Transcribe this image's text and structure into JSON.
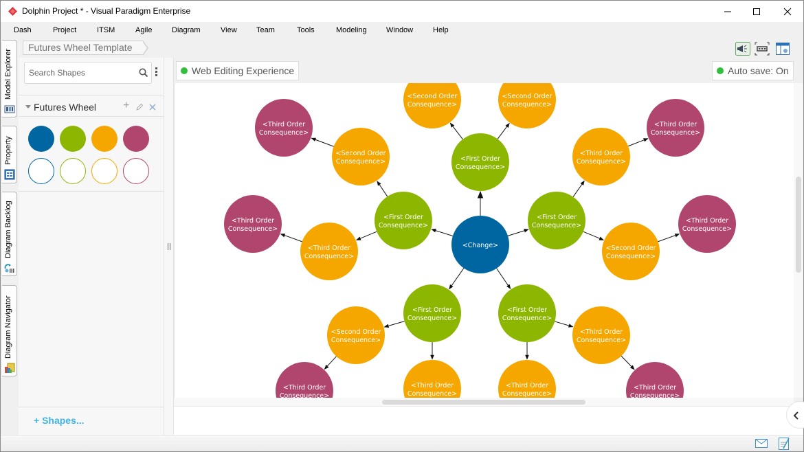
{
  "window": {
    "title": "Dolphin Project * - Visual Paradigm Enterprise",
    "controls": {
      "minimize": "minimize",
      "maximize": "maximize",
      "close": "close"
    }
  },
  "menubar": {
    "items": [
      {
        "label": "Dash"
      },
      {
        "label": "Project"
      },
      {
        "label": "ITSM"
      },
      {
        "label": "Agile"
      },
      {
        "label": "Diagram"
      },
      {
        "label": "View"
      },
      {
        "label": "Team"
      },
      {
        "label": "Tools"
      },
      {
        "label": "Modeling"
      },
      {
        "label": "Window"
      },
      {
        "label": "Help"
      }
    ]
  },
  "left_tabs": [
    {
      "label": "Model Explorer",
      "icon": "model-explorer-icon"
    },
    {
      "label": "Property",
      "icon": "property-icon"
    },
    {
      "label": "Diagram Backlog",
      "icon": "diagram-backlog-icon"
    },
    {
      "label": "Diagram Navigator",
      "icon": "diagram-navigator-icon"
    }
  ],
  "breadcrumb": {
    "label": "Futures Wheel Template"
  },
  "toolbar": {
    "icons": [
      "announcement-icon",
      "fit-diagram-icon",
      "layout-panel-icon"
    ]
  },
  "shape_panel": {
    "search_placeholder": "Search Shapes",
    "search_value": "",
    "category": {
      "title": "Futures Wheel",
      "actions": [
        "add",
        "edit",
        "close"
      ]
    },
    "swatches": [
      {
        "style": "filled",
        "color": "#0066a1"
      },
      {
        "style": "filled",
        "color": "#8db600"
      },
      {
        "style": "filled",
        "color": "#f5a700"
      },
      {
        "style": "filled",
        "color": "#b0466d"
      },
      {
        "style": "outline",
        "color": "#0066a1"
      },
      {
        "style": "outline",
        "color": "#8db600"
      },
      {
        "style": "outline",
        "color": "#f5a700"
      },
      {
        "style": "outline",
        "color": "#b0466d"
      }
    ],
    "add_shapes_label": "Shapes..."
  },
  "canvas_header": {
    "web_editing_label": "Web Editing Experience",
    "autosave_label": "Auto save: On",
    "status_color": "#2fbf3c"
  },
  "diagram": {
    "colors": {
      "change": "#0066a1",
      "first": "#8db600",
      "second": "#f5a700",
      "third_orange": "#f5a700",
      "third": "#b0466d"
    },
    "nodes": [
      {
        "id": "c",
        "kind": "change",
        "line1": "<Change>",
        "line2": ""
      },
      {
        "id": "f1",
        "kind": "first",
        "line1": "<First Order",
        "line2": "Consequence>"
      },
      {
        "id": "f2",
        "kind": "first",
        "line1": "<First Order",
        "line2": "Consequence>"
      },
      {
        "id": "f3",
        "kind": "first",
        "line1": "<First Order",
        "line2": "Consequence>"
      },
      {
        "id": "f4",
        "kind": "first",
        "line1": "<First Order",
        "line2": "Consequence>"
      },
      {
        "id": "f5",
        "kind": "first",
        "line1": "<First Order",
        "line2": "Consequence>"
      },
      {
        "id": "s1",
        "kind": "second",
        "line1": "<Second Order",
        "line2": "Consequence>"
      },
      {
        "id": "s2",
        "kind": "second",
        "line1": "<Second Order",
        "line2": "Consequence>"
      },
      {
        "id": "s3",
        "kind": "second",
        "line1": "<Second Order",
        "line2": "Consequence>"
      },
      {
        "id": "s4",
        "kind": "second",
        "line1": "<Second Order",
        "line2": "Consequence>"
      },
      {
        "id": "s5",
        "kind": "second",
        "line1": "<Second Order",
        "line2": "Consequence>"
      },
      {
        "id": "o1",
        "kind": "third_orange",
        "line1": "<Third Order",
        "line2": "Consequence>"
      },
      {
        "id": "o2",
        "kind": "third_orange",
        "line1": "<Third Order",
        "line2": "Consequence>"
      },
      {
        "id": "o3",
        "kind": "third_orange",
        "line1": "<Third Order",
        "line2": "Consequence>"
      },
      {
        "id": "o4",
        "kind": "third_orange",
        "line1": "<Third Order",
        "line2": "Consequence>"
      },
      {
        "id": "o5",
        "kind": "third_orange",
        "line1": "<Third Order",
        "line2": "Consequence>"
      },
      {
        "id": "t1",
        "kind": "third",
        "line1": "<Third Order",
        "line2": "Consequence>"
      },
      {
        "id": "t2",
        "kind": "third",
        "line1": "<Third Order",
        "line2": "Consequence>"
      },
      {
        "id": "t3",
        "kind": "third",
        "line1": "<Third Order",
        "line2": "Consequence>"
      },
      {
        "id": "t4",
        "kind": "third",
        "line1": "<Third Order",
        "line2": "Consequence>"
      },
      {
        "id": "t5",
        "kind": "third",
        "line1": "<Third Order",
        "line2": "Consequence>"
      },
      {
        "id": "t6",
        "kind": "third",
        "line1": "<Third Order",
        "line2": "Consequence>"
      }
    ],
    "edges": [
      [
        "c",
        "f1"
      ],
      [
        "c",
        "f2"
      ],
      [
        "c",
        "f3"
      ],
      [
        "c",
        "f4"
      ],
      [
        "c",
        "f5"
      ],
      [
        "f1",
        "s1"
      ],
      [
        "f1",
        "s2"
      ],
      [
        "f2",
        "s3"
      ],
      [
        "f2",
        "o1"
      ],
      [
        "f3",
        "o2"
      ],
      [
        "f3",
        "s4"
      ],
      [
        "f4",
        "s5"
      ],
      [
        "f4",
        "o3"
      ],
      [
        "f5",
        "o4"
      ],
      [
        "f5",
        "o5"
      ],
      [
        "s3",
        "t1"
      ],
      [
        "o1",
        "t2"
      ],
      [
        "o2",
        "t3"
      ],
      [
        "s4",
        "t4"
      ],
      [
        "s5",
        "t5"
      ],
      [
        "o5",
        "t6"
      ]
    ]
  },
  "statusbar": {
    "icons": [
      "mail-icon",
      "notes-icon"
    ]
  }
}
